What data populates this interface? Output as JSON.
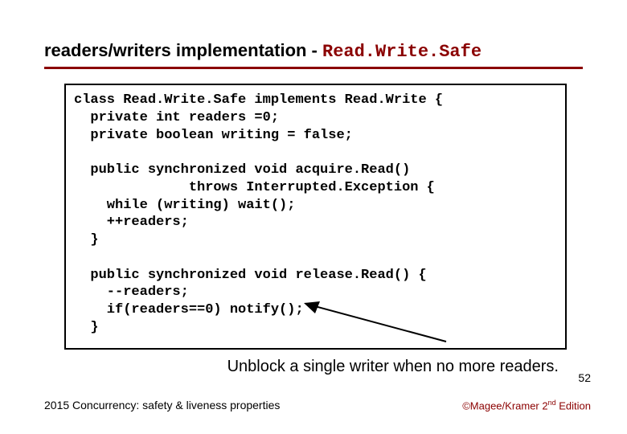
{
  "title_prefix": "readers/writers implementation - ",
  "title_code": "Read.Write.Safe",
  "code_lines": [
    "class Read.Write.Safe implements Read.Write {",
    "  private int readers =0;",
    "  private boolean writing = false;",
    "",
    "  public synchronized void acquire.Read()",
    "              throws Interrupted.Exception {",
    "    while (writing) wait();",
    "    ++readers;",
    "  }",
    "",
    "  public synchronized void release.Read() {",
    "    --readers;",
    "    if(readers==0) notify();",
    "  }"
  ],
  "caption": "Unblock a single writer when no more readers.",
  "slide_number": "52",
  "footer_left": "2015  Concurrency: safety & liveness properties",
  "footer_right_author": "©Magee/Kramer ",
  "footer_right_edition_num": "2",
  "footer_right_edition_sup": "nd",
  "footer_right_edition_word": " Edition"
}
